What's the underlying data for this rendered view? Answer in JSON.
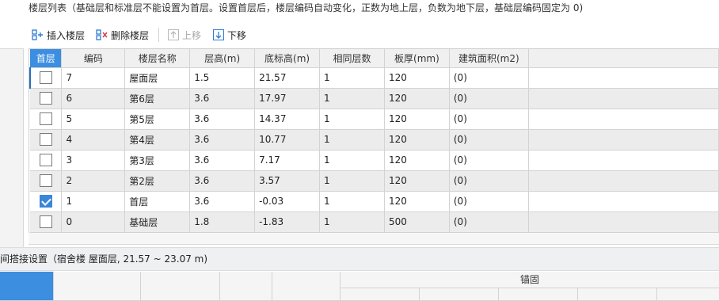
{
  "header": {
    "title": "楼层列表（基础层和标准层不能设置为首层。设置首层后，楼层编码自动变化，正数为地上层，负数为地下层，基础层编码固定为 0)"
  },
  "toolbar": {
    "insert_label": "插入楼层",
    "delete_label": "删除楼层",
    "up_label": "上移",
    "down_label": "下移"
  },
  "table": {
    "columns": [
      "首层",
      "编码",
      "楼层名称",
      "层高(m)",
      "底标高(m)",
      "相同层数",
      "板厚(mm)",
      "建筑面积(m2)"
    ],
    "rows": [
      {
        "first": false,
        "code": "7",
        "name": "屋面层",
        "height": "1.5",
        "bottom": "21.57",
        "same": "1",
        "slab": "120",
        "area": "(0)"
      },
      {
        "first": false,
        "code": "6",
        "name": "第6层",
        "height": "3.6",
        "bottom": "17.97",
        "same": "1",
        "slab": "120",
        "area": "(0)"
      },
      {
        "first": false,
        "code": "5",
        "name": "第5层",
        "height": "3.6",
        "bottom": "14.37",
        "same": "1",
        "slab": "120",
        "area": "(0)"
      },
      {
        "first": false,
        "code": "4",
        "name": "第4层",
        "height": "3.6",
        "bottom": "10.77",
        "same": "1",
        "slab": "120",
        "area": "(0)"
      },
      {
        "first": false,
        "code": "3",
        "name": "第3层",
        "height": "3.6",
        "bottom": "7.17",
        "same": "1",
        "slab": "120",
        "area": "(0)"
      },
      {
        "first": false,
        "code": "2",
        "name": "第2层",
        "height": "3.6",
        "bottom": "3.57",
        "same": "1",
        "slab": "120",
        "area": "(0)"
      },
      {
        "first": true,
        "code": "1",
        "name": "首层",
        "height": "3.6",
        "bottom": "-0.03",
        "same": "1",
        "slab": "120",
        "area": "(0)"
      },
      {
        "first": false,
        "code": "0",
        "name": "基础层",
        "height": "1.8",
        "bottom": "-1.83",
        "same": "1",
        "slab": "500",
        "area": "(0)"
      }
    ]
  },
  "section": {
    "label": "间搭接设置（宿舍楼  屋面层, 21.57 ~ 23.07 m)"
  },
  "bottom_table": {
    "anchor_label": "锚固"
  },
  "colors": {
    "accent": "#3b8ee0",
    "alt_row": "#ececec"
  }
}
